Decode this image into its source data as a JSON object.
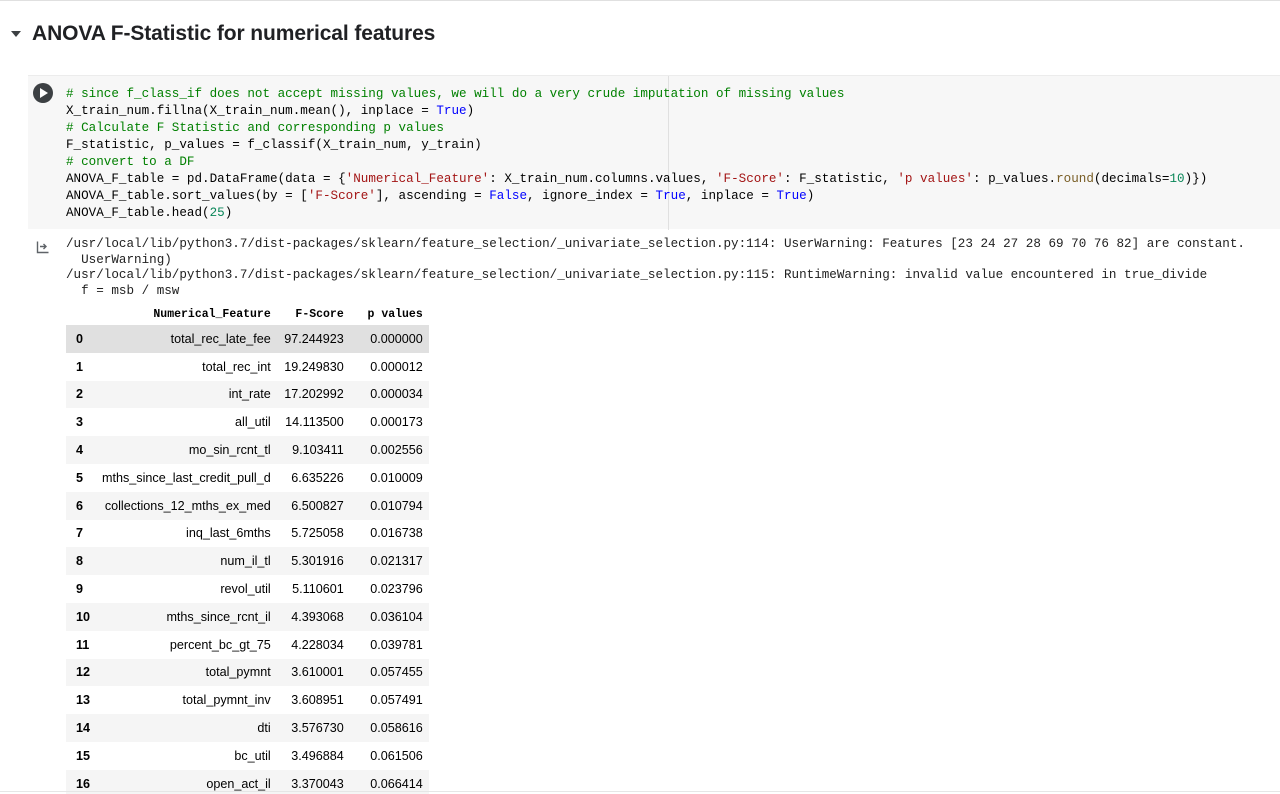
{
  "section": {
    "title": "ANOVA F-Statistic for numerical features"
  },
  "code": {
    "line1": "# since f_class_if does not accept missing values, we will do a very crude imputation of missing values",
    "line2a": "X_train_num.fillna(X_train_num.mean(), inplace = ",
    "line2b": "True",
    "line2c": ")",
    "line3": "# Calculate F Statistic and corresponding p values",
    "line4": "F_statistic, p_values = f_classif(X_train_num, y_train)",
    "line5": "# convert to a DF",
    "line6a": "ANOVA_F_table = pd.DataFrame(data = {",
    "line6b": "'Numerical_Feature'",
    "line6c": ": X_train_num.columns.values, ",
    "line6d": "'F-Score'",
    "line6e": ": F_statistic, ",
    "line6f": "'p values'",
    "line6g": ": p_values.",
    "line6h": "round",
    "line6i": "(decimals=",
    "line6j": "10",
    "line6k": ")})",
    "line7a": "ANOVA_F_table.sort_values(by = [",
    "line7b": "'F-Score'",
    "line7c": "], ascending = ",
    "line7d": "False",
    "line7e": ", ignore_index = ",
    "line7f": "True",
    "line7g": ", inplace = ",
    "line7h": "True",
    "line7i": ")",
    "line8a": "ANOVA_F_table.head(",
    "line8b": "25",
    "line8c": ")"
  },
  "output": {
    "warning1": "/usr/local/lib/python3.7/dist-packages/sklearn/feature_selection/_univariate_selection.py:114: UserWarning: Features [23 24 27 28 69 70 76 82] are constant.",
    "warning1_cont": "  UserWarning)",
    "warning2": "/usr/local/lib/python3.7/dist-packages/sklearn/feature_selection/_univariate_selection.py:115: RuntimeWarning: invalid value encountered in true_divide",
    "warning2_cont": "  f = msb / msw"
  },
  "table": {
    "headers": [
      "",
      "Numerical_Feature",
      "F-Score",
      "p values"
    ],
    "rows": [
      [
        "0",
        "total_rec_late_fee",
        "97.244923",
        "0.000000"
      ],
      [
        "1",
        "total_rec_int",
        "19.249830",
        "0.000012"
      ],
      [
        "2",
        "int_rate",
        "17.202992",
        "0.000034"
      ],
      [
        "3",
        "all_util",
        "14.113500",
        "0.000173"
      ],
      [
        "4",
        "mo_sin_rcnt_tl",
        "9.103411",
        "0.002556"
      ],
      [
        "5",
        "mths_since_last_credit_pull_d",
        "6.635226",
        "0.010009"
      ],
      [
        "6",
        "collections_12_mths_ex_med",
        "6.500827",
        "0.010794"
      ],
      [
        "7",
        "inq_last_6mths",
        "5.725058",
        "0.016738"
      ],
      [
        "8",
        "num_il_tl",
        "5.301916",
        "0.021317"
      ],
      [
        "9",
        "revol_util",
        "5.110601",
        "0.023796"
      ],
      [
        "10",
        "mths_since_rcnt_il",
        "4.393068",
        "0.036104"
      ],
      [
        "11",
        "percent_bc_gt_75",
        "4.228034",
        "0.039781"
      ],
      [
        "12",
        "total_pymnt",
        "3.610001",
        "0.057455"
      ],
      [
        "13",
        "total_pymnt_inv",
        "3.608951",
        "0.057491"
      ],
      [
        "14",
        "dti",
        "3.576730",
        "0.058616"
      ],
      [
        "15",
        "bc_util",
        "3.496884",
        "0.061506"
      ],
      [
        "16",
        "open_act_il",
        "3.370043",
        "0.066414"
      ]
    ]
  },
  "icons": {
    "collapse": "caret-down-icon",
    "run": "play-icon",
    "output": "output-arrow-icon"
  },
  "colors": {
    "comment": "#008000",
    "keyword": "#0000ff",
    "string": "#a31515",
    "number": "#098658"
  }
}
